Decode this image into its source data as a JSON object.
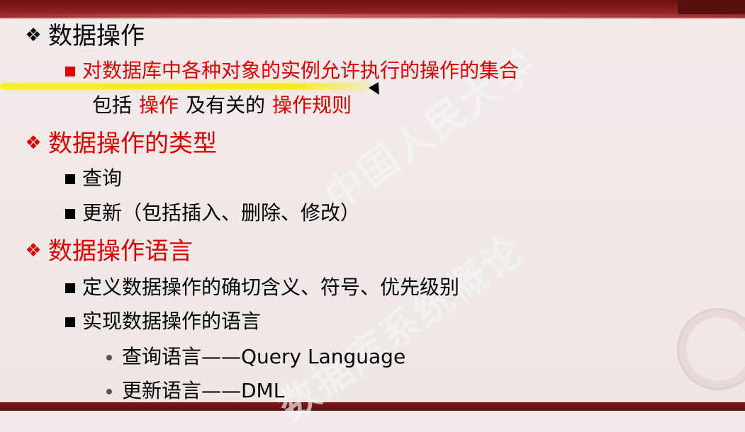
{
  "slide": {
    "bullets_icons": {
      "diamond": "diamond-bullet-icon",
      "square": "square-bullet-icon",
      "dot": "dot-bullet-icon"
    },
    "colors": {
      "text_black": "#000000",
      "text_red": "#e00000",
      "highlight_yellow": "#f7ea1a",
      "band_red": "#8f1e1e"
    },
    "section1": {
      "title": "数据操作",
      "line1": "对数据库中各种对象的实例允许执行的操作的集合",
      "line2_parts": [
        "包括",
        "操作",
        "及有关的",
        "操作规则"
      ]
    },
    "section2": {
      "title": "数据操作的类型",
      "items": [
        "查询",
        "更新（包括插入、删除、修改）"
      ]
    },
    "section3": {
      "title": "数据操作语言",
      "items": [
        "定义数据操作的确切含义、符号、优先级别",
        "实现数据操作的语言"
      ],
      "subitems": [
        "查询语言——Query Language",
        "更新语言——DML"
      ]
    }
  }
}
